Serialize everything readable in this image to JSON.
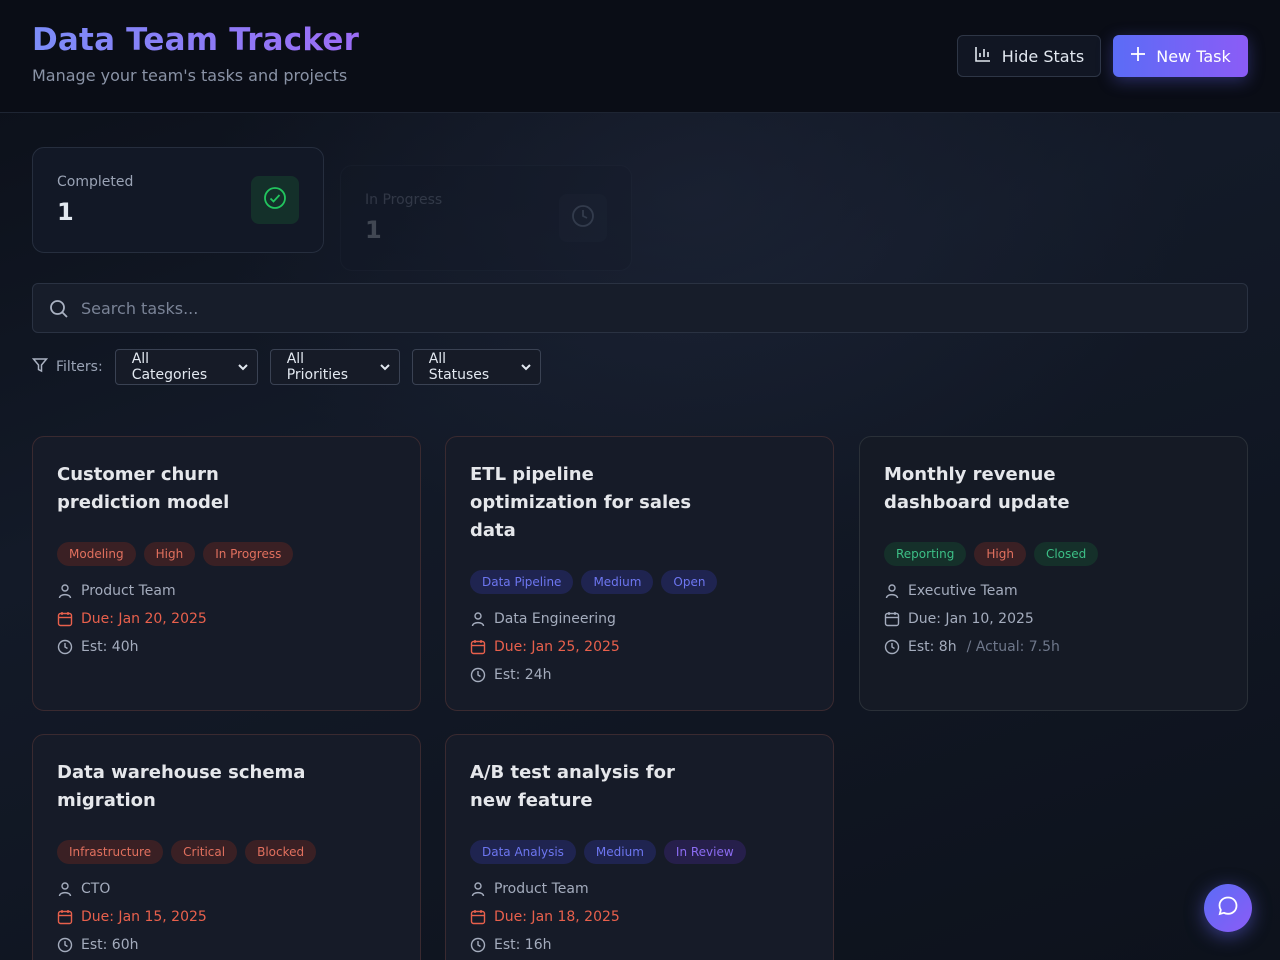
{
  "header": {
    "title": "Data Team Tracker",
    "subtitle": "Manage your team's tasks and projects",
    "hide_stats_label": "Hide Stats",
    "new_task_label": "New Task"
  },
  "stats": [
    {
      "label": "Completed",
      "value": "1",
      "icon": "check-circle-icon",
      "color": "#22c55e"
    },
    {
      "label": "In Progress",
      "value": "1",
      "icon": "clock-icon",
      "color": "#94a3b8"
    }
  ],
  "search": {
    "placeholder": "Search tasks...",
    "value": ""
  },
  "filters": {
    "label": "Filters:",
    "category": "All Categories",
    "priority": "All Priorities",
    "status": "All Statuses"
  },
  "tasks": [
    {
      "title": "Customer churn prediction model",
      "category": "Modeling",
      "priority": "High",
      "status": "In Progress",
      "owner": "Product Team",
      "due": "Due: Jan 20, 2025",
      "est": "Est: 40h"
    },
    {
      "title": "ETL pipeline optimization for sales data",
      "category": "Data Pipeline",
      "priority": "Medium",
      "status": "Open",
      "owner": "Data Engineering",
      "due": "Due: Jan 25, 2025",
      "est": "Est: 24h"
    },
    {
      "title": "Monthly revenue dashboard update",
      "category": "Reporting",
      "priority": "High",
      "status": "Closed",
      "owner": "Executive Team",
      "due": "Due: Jan 10, 2025",
      "est": "Est: 8h",
      "actual": "/ Actual: 7.5h"
    },
    {
      "title": "Data warehouse schema migration",
      "category": "Infrastructure",
      "priority": "Critical",
      "status": "Blocked",
      "owner": "CTO",
      "due": "Due: Jan 15, 2025",
      "est": "Est: 60h"
    },
    {
      "title": "A/B test analysis for new feature",
      "category": "Data Analysis",
      "priority": "Medium",
      "status": "In Review",
      "owner": "Product Team",
      "due": "Due: Jan 18, 2025",
      "est": "Est: 16h"
    }
  ],
  "colors": {
    "accent_start": "#5b6cf6",
    "accent_end": "#8b5cf6",
    "due_red": "#e8604c",
    "completed_green": "#22c55e"
  }
}
